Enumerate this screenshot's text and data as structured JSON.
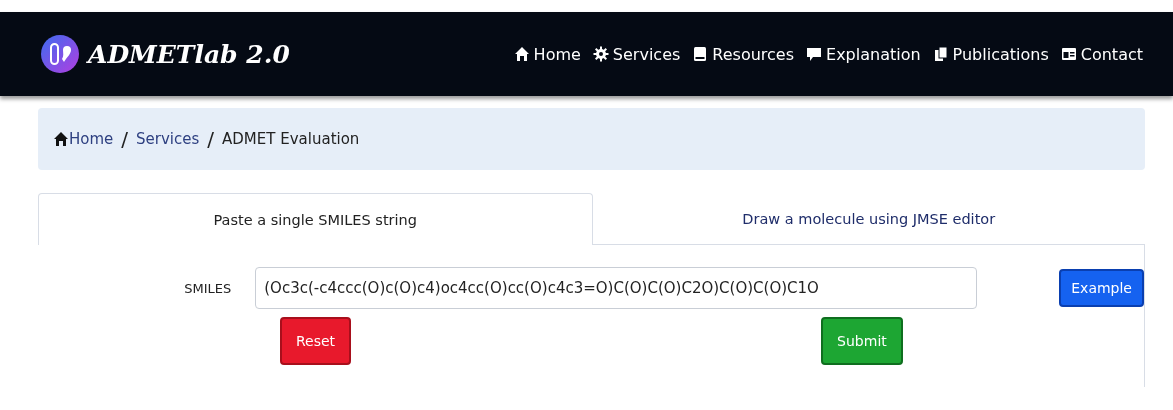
{
  "navbar": {
    "brand": "ADMETlab 2.0",
    "items": [
      {
        "label": "Home",
        "kind": "home"
      },
      {
        "label": "Services",
        "kind": "gear"
      },
      {
        "label": "Resources",
        "kind": "book"
      },
      {
        "label": "Explanation",
        "kind": "comment"
      },
      {
        "label": "Publications",
        "kind": "copy"
      },
      {
        "label": "Contact",
        "kind": "card"
      }
    ]
  },
  "breadcrumb": [
    {
      "label": "Home",
      "kind": "home"
    },
    {
      "label": "/",
      "kind": "separator"
    },
    {
      "label": "Services",
      "kind": "link"
    },
    {
      "label": "/",
      "kind": "separator"
    },
    {
      "label": "ADMET Evaluation",
      "kind": "current"
    }
  ],
  "tabs": [
    {
      "label": "Paste a single SMILES string",
      "selected": true
    },
    {
      "label": "Draw a molecule using JMSE editor",
      "selected": false
    }
  ],
  "form": {
    "label": "SMILES",
    "value": "(Oc3c(-c4ccc(O)c(O)c4)oc4cc(O)cc(O)c4c3=O)C(O)C(O)C2O)C(O)C(O)C1O",
    "example_button": "Example",
    "reset_button": "Reset",
    "submit_button": "Submit"
  }
}
